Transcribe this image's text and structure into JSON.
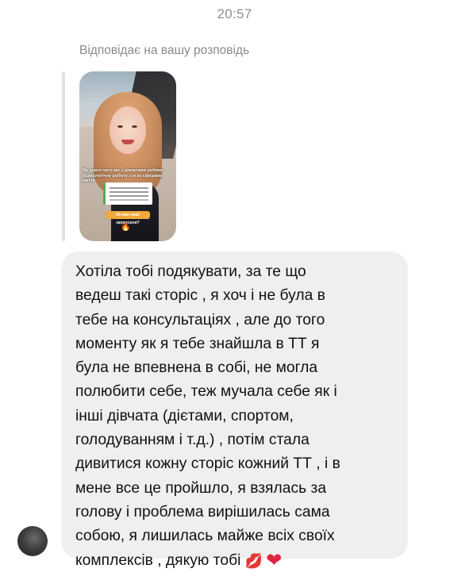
{
  "header": {
    "timestamp": "20:57"
  },
  "reply": {
    "label": "Відповідає на вашу розповідь"
  },
  "story": {
    "caption": "Як довго чого ми з дівчатами робимо психологічну роботу з усім сферами життя",
    "question": "Як вам наші запросили?",
    "flame": "🔥"
  },
  "message": {
    "text": "Хотіла тобі подякувати, за те що\nведеш такі сторіс , я хоч і не була в\nтебе на консультаціях , але до того\nмоменту як я тебе знайшла в ТТ я\nбула не впевнена в собі, не могла\nполюбити себе, теж мучала себе як і\nінші дівчата (дієтами, спортом,\nголодуванням і т.д.) , потім стала\nдивитися кожну сторіс кожний ТТ , і в\nмене все це пройшло, я взялась за\nголову і проблема вирішилась сама\nсобою, я лишилась майже всіх своїх\nкомплексів , дякую тобі",
    "emoji_kiss": "💋",
    "emoji_heart": "❤"
  }
}
